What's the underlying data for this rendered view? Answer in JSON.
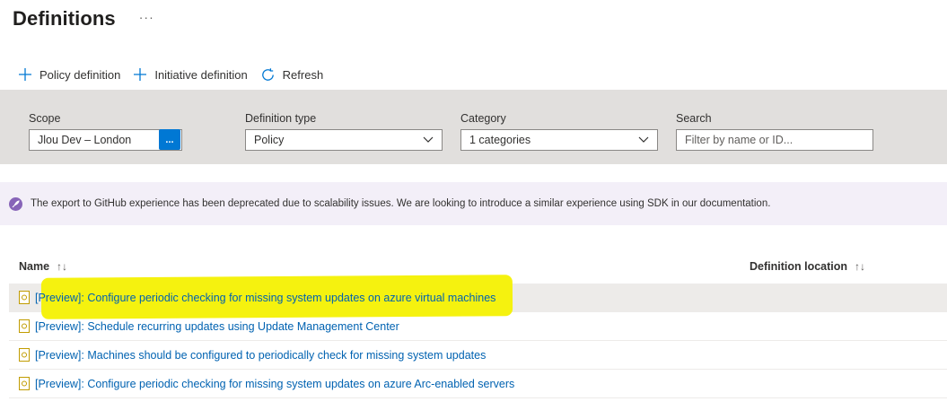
{
  "header": {
    "title": "Definitions",
    "more_label": "···"
  },
  "toolbar": {
    "policy_definition": "Policy definition",
    "initiative_definition": "Initiative definition",
    "refresh": "Refresh"
  },
  "filters": {
    "scope": {
      "label": "Scope",
      "value": "Jlou Dev – London",
      "button_label": "..."
    },
    "definition_type": {
      "label": "Definition type",
      "value": "Policy"
    },
    "category": {
      "label": "Category",
      "value": "1 categories"
    },
    "search": {
      "label": "Search",
      "placeholder": "Filter by name or ID..."
    }
  },
  "banner": {
    "text": "The export to GitHub experience has been deprecated due to scalability issues. We are looking to introduce a similar experience using SDK in our documentation."
  },
  "table": {
    "columns": {
      "name": "Name",
      "definition_location": "Definition location",
      "sort_glyph": "↑↓"
    },
    "rows": [
      {
        "name": "[Preview]: Configure periodic checking for missing system updates on azure virtual machines"
      },
      {
        "name": "[Preview]: Schedule recurring updates using Update Management Center"
      },
      {
        "name": "[Preview]: Machines should be configured to periodically check for missing system updates"
      },
      {
        "name": "[Preview]: Configure periodic checking for missing system updates on azure Arc-enabled servers"
      }
    ]
  },
  "colors": {
    "accent": "#0078d4",
    "link": "#0062b1",
    "filter_bar": "#e1dfdd",
    "banner_bg": "#f3eff8",
    "banner_icon": "#8764b8",
    "highlight": "#f5f207",
    "policy_icon": "#c19c00"
  },
  "icons": {
    "add": "plus-icon",
    "refresh": "refresh-icon",
    "chevron": "chevron-down-icon",
    "banner": "rocket-icon",
    "row": "policy-document-icon"
  }
}
